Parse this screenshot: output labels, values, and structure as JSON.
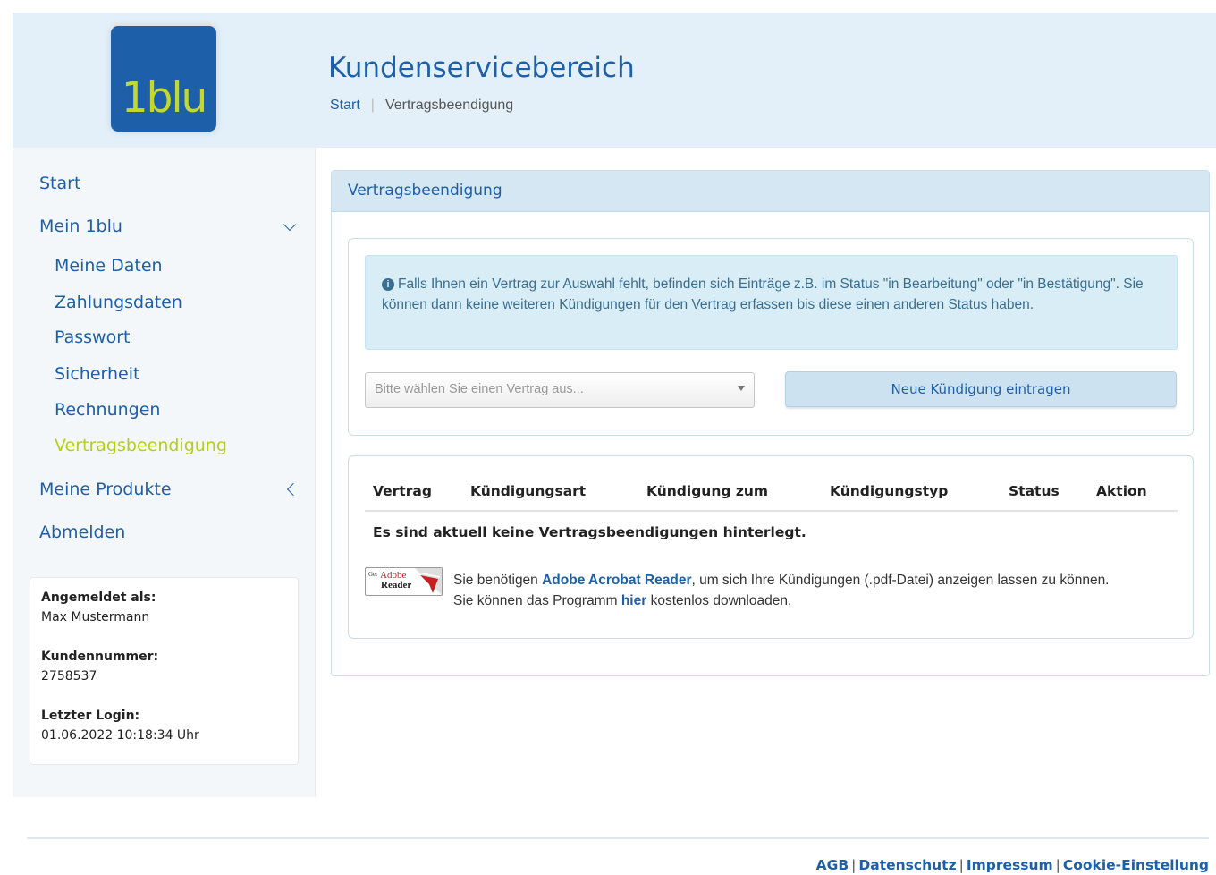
{
  "header": {
    "logo_text": "1blu",
    "title": "Kundenservicebereich",
    "breadcrumb": [
      "Start",
      "Vertragsbeendigung"
    ]
  },
  "sidebar": {
    "items": [
      {
        "label": "Start"
      },
      {
        "label": "Mein 1blu",
        "expanded": true
      },
      {
        "label": "Meine Daten"
      },
      {
        "label": "Zahlungsdaten"
      },
      {
        "label": "Passwort"
      },
      {
        "label": "Sicherheit"
      },
      {
        "label": "Rechnungen"
      },
      {
        "label": "Vertragsbeendigung",
        "active": true
      },
      {
        "label": "Meine Produkte"
      },
      {
        "label": "Abmelden"
      }
    ],
    "account": {
      "logged_in_label": "Angemeldet als:",
      "logged_in_value": "Max Mustermann",
      "customer_no_label": "Kundennummer:",
      "customer_no_value": "2758537",
      "last_login_label": "Letzter Login:",
      "last_login_value": "01.06.2022 10:18:34 Uhr"
    }
  },
  "main": {
    "panel_title": "Vertragsbeendigung",
    "alert_text": "Falls Ihnen ein Vertrag zur Auswahl fehlt, befinden sich Einträge z.B. im Status \"in Bearbeitung\" oder \"in Bestätigung\". Sie können dann keine weiteren Kündigungen für den Vertrag erfassen bis diese einen anderen Status haben.",
    "select_placeholder": "Bitte wählen Sie einen Vertrag aus...",
    "new_button": "Neue Kündigung eintragen",
    "table_headers": [
      "Vertrag",
      "Kündigungsart",
      "Kündigung zum",
      "Kündigungstyp",
      "Status",
      "Aktion"
    ],
    "empty_message": "Es sind aktuell keine Vertragsbeendigungen hinterlegt.",
    "adobe_badge": {
      "get": "Get",
      "brand": "Adobe",
      "product": "Reader"
    },
    "download_text": {
      "part1": "Sie benötigen ",
      "link1": "Adobe Acrobat Reader",
      "part2": ", um sich Ihre Kündigungen (.pdf-Datei) anzeigen lassen zu können.",
      "part3": "Sie können das Programm ",
      "link2": "hier",
      "part4": " kostenlos downloaden."
    }
  },
  "footer": {
    "links": [
      "AGB",
      "Datenschutz",
      "Impressum",
      "Cookie-Einstellung"
    ],
    "separator": "|"
  },
  "colors": {
    "brand_blue": "#1d5fa8",
    "brand_green": "#b6cd1c",
    "header_bg": "#e3f0f9",
    "alert_bg": "#d9edf7"
  }
}
